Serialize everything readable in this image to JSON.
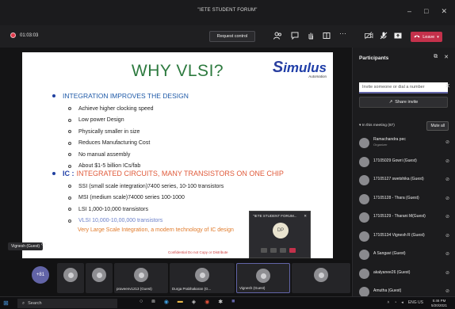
{
  "window": {
    "title": "\"IETE STUDENT FORUM\"",
    "controls": [
      "–",
      "□",
      "✕"
    ]
  },
  "toolbar": {
    "timer": "01:03:03",
    "request_control": "Request control",
    "leave": "Leave",
    "icons": [
      "people-icon",
      "chat-icon",
      "raise-hand-icon",
      "rooms-icon",
      "more-icon",
      "camera-off-icon",
      "mic-off-icon",
      "share-icon",
      "leave-phone-icon"
    ]
  },
  "slide": {
    "title": "WHY VLSI?",
    "logo_s": "S",
    "logo_rest": "imulus",
    "logo_sub": "Automation",
    "bullet1": "INTEGRATION IMPROVES THE DESIGN",
    "items1": [
      "Achieve higher clocking speed",
      "Low power Design",
      "Physically smaller in size",
      "Reduces Manufacturing Cost",
      "No manual assembly",
      "About $1-5 billion ICs/fab"
    ],
    "ic_label": "IC :",
    "ic_text": "INTEGRATED CIRCUITS, MANY TRANSISTORS ON ONE CHIP",
    "items2": [
      "SSI (small scale integration)7400 series, 10-100 transistors",
      "MSI (medium scale)74000 series 100-1000",
      "LSI 1,000-10,000 transistors",
      "VLSI  10,000-10,00,000  transistors"
    ],
    "vlsi_desc": "Very Large Scale Integration, a modern technology of IC design",
    "confidential": "Confidential Do not Copy or Distribute"
  },
  "stage": {
    "presenter_tag": "Vignesh (Guest)"
  },
  "mini_window": {
    "title": "\"IETE STUDENT FORUM...",
    "avatar": "DP"
  },
  "tiles": {
    "more_count": "+81",
    "labels": [
      "",
      "",
      "",
      "praveenv1213 (Guest)",
      "Durga Prabhakaran (G...",
      "Vignesh (Guest)",
      ""
    ]
  },
  "participants": {
    "title": "Participants",
    "invite_placeholder": "Invite someone or dial a number",
    "share_invite": "Share invite",
    "in_meeting": "In this meeting (87)",
    "mute_all": "Mute all",
    "list": [
      {
        "name": "Ramachandra pec",
        "role": "Organizer"
      },
      {
        "name": "17105029 Gowri (Guest)",
        "role": ""
      },
      {
        "name": "17105127 swetshika (Guest)",
        "role": ""
      },
      {
        "name": "17105128 - Thara (Guest)",
        "role": ""
      },
      {
        "name": "17105129 - Tharani M(Guest)",
        "role": ""
      },
      {
        "name": "17105134 Vignesh R (Guest)",
        "role": ""
      },
      {
        "name": "A Sangavi (Guest)",
        "role": ""
      },
      {
        "name": "akalyanee26 (Guest)",
        "role": ""
      },
      {
        "name": "Amutha (Guest)",
        "role": ""
      }
    ]
  },
  "taskbar": {
    "search": "Search",
    "time": "5:46 PM",
    "date": "5/20/2021",
    "lang": "ENG",
    "region": "US"
  }
}
